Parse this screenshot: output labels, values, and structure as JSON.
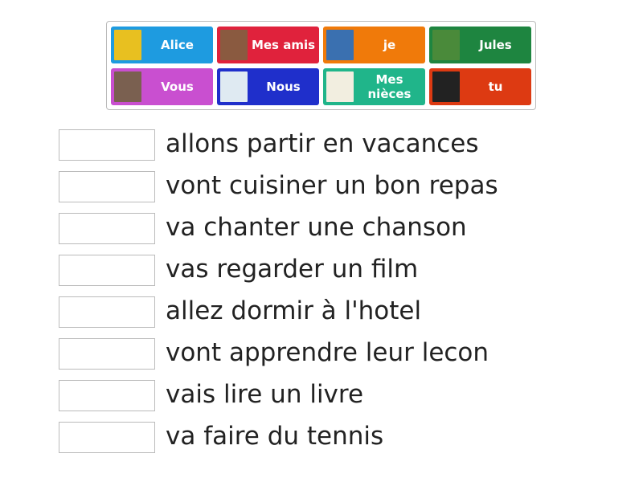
{
  "tiles": [
    {
      "label": "Alice",
      "color": "#1e9be0",
      "icon": "woman-cartoon-image"
    },
    {
      "label": "Mes amis",
      "color": "#e0223c",
      "icon": "friends-photo-image"
    },
    {
      "label": "je",
      "color": "#f07a0a",
      "icon": "reading-newspaper-image"
    },
    {
      "label": "Jules",
      "color": "#1e8540",
      "icon": "tennis-racket-image"
    },
    {
      "label": "Vous",
      "color": "#c94fd0",
      "icon": "hotel-pool-image"
    },
    {
      "label": "Nous",
      "color": "#1f2fcb",
      "icon": "globe-suitcase-image"
    },
    {
      "label": "Mes nièces",
      "color": "#20b58a",
      "icon": "open-book-image"
    },
    {
      "label": "tu",
      "color": "#dd3a12",
      "icon": "tv-channels-image"
    }
  ],
  "sentences": [
    "allons partir en vacances",
    "vont cuisiner un bon repas",
    "va chanter une chanson",
    "vas regarder un film",
    "allez dormir à l'hotel",
    "vont apprendre leur lecon",
    "vais lire un livre",
    "va faire du tennis"
  ]
}
